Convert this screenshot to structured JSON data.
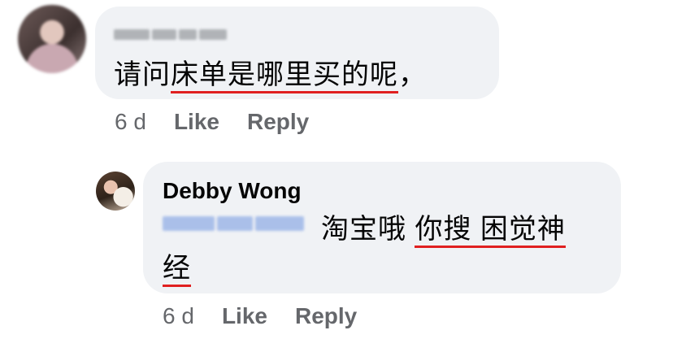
{
  "comments": [
    {
      "text_prefix": "请问",
      "text_underlined": "床单是哪里买的呢",
      "text_suffix": "，",
      "time": "6 d",
      "like_label": "Like",
      "reply_label": "Reply"
    },
    {
      "author": "Debby Wong",
      "mention_text": "",
      "text_line1_plain": "淘宝哦 ",
      "text_line1_underlined": "你搜 困觉神",
      "text_line2_underlined": "经",
      "time": "6 d",
      "like_label": "Like",
      "reply_label": "Reply"
    }
  ],
  "colors": {
    "bubble_bg": "#f0f2f5",
    "meta_text": "#65676b",
    "underline_red": "#e02020"
  }
}
